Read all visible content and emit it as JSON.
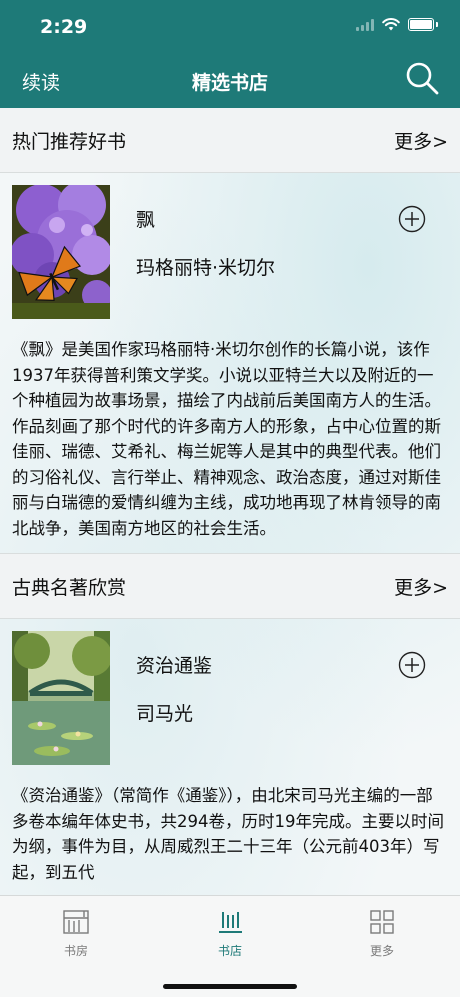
{
  "status_bar": {
    "time": "2:29"
  },
  "nav": {
    "left_label": "续读",
    "title": "精选书店"
  },
  "sections": [
    {
      "title": "热门推荐好书",
      "more": "更多>",
      "book": {
        "title": "飘",
        "author": "玛格丽特·米切尔",
        "description": "《飘》是美国作家玛格丽特·米切尔创作的长篇小说，该作1937年获得普利策文学奖。小说以亚特兰大以及附近的一个种植园为故事场景，描绘了内战前后美国南方人的生活。作品刻画了那个时代的许多南方人的形象，占中心位置的斯佳丽、瑞德、艾希礼、梅兰妮等人是其中的典型代表。他们的习俗礼仪、言行举止、精神观念、政治态度，通过对斯佳丽与白瑞德的爱情纠缠为主线，成功地再现了林肯领导的南北战争，美国南方地区的社会生活。"
      }
    },
    {
      "title": "古典名著欣赏",
      "more": "更多>",
      "book": {
        "title": "资治通鉴",
        "author": "司马光",
        "description": "《资治通鉴》（常简作《通鉴》），由北宋司马光主编的一部多卷本编年体史书，共294卷，历时19年完成。主要以时间为纲，事件为目，从周威烈王二十三年（公元前403年）写起，到五代"
      }
    }
  ],
  "tabs": [
    {
      "label": "书房",
      "icon": "bookshelf-icon",
      "active": false
    },
    {
      "label": "书店",
      "icon": "bookstore-icon",
      "active": true
    },
    {
      "label": "更多",
      "icon": "grid-icon",
      "active": false
    }
  ],
  "colors": {
    "accent": "#1e7a78",
    "tab_inactive": "#7a7a7a"
  }
}
